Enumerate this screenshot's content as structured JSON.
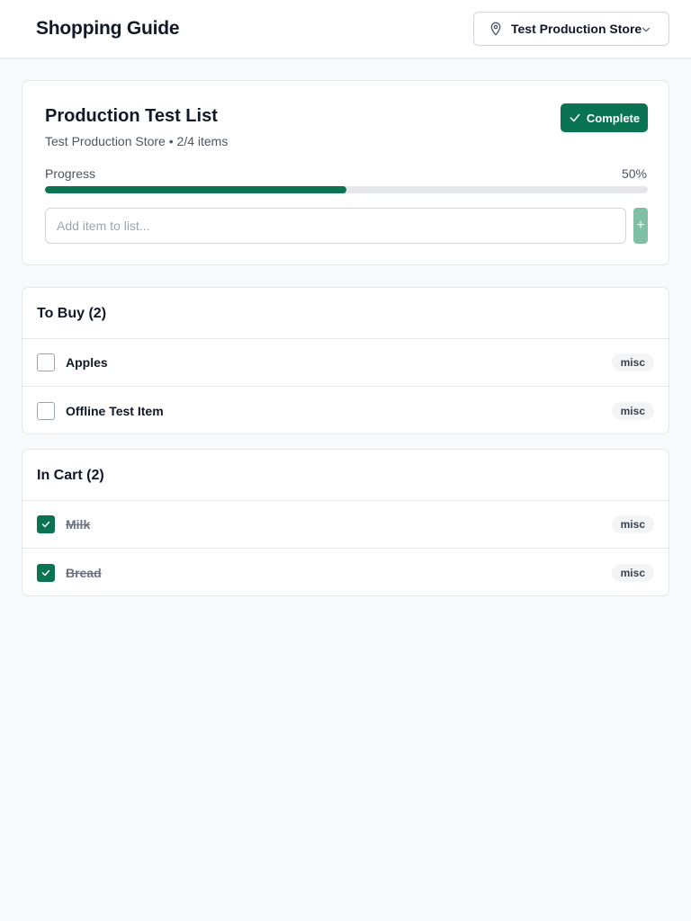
{
  "app": {
    "title": "Shopping Guide"
  },
  "store_selector": {
    "label": "Test Production Store",
    "icon": "map-pin-icon"
  },
  "list": {
    "title": "Production Test List",
    "subtitle": "Test Production Store • 2/4 items",
    "complete_label": "Complete",
    "progress_label": "Progress",
    "progress_text": "50%",
    "progress_fraction": 0.5,
    "add_placeholder": "Add item to list...",
    "add_button": "+"
  },
  "to_buy": {
    "title": "To Buy (2)",
    "items": [
      {
        "name": "Apples",
        "tag": "misc",
        "checked": false
      },
      {
        "name": "Offline Test Item",
        "tag": "misc",
        "checked": false
      }
    ]
  },
  "in_cart": {
    "title": "In Cart (2)",
    "items": [
      {
        "name": "Milk",
        "tag": "misc",
        "checked": true
      },
      {
        "name": "Bread",
        "tag": "misc",
        "checked": true
      }
    ]
  },
  "colors": {
    "accent": "#0a7352",
    "accent_light": "#7fbfa6",
    "border": "#e5e7eb",
    "background": "#f8f9fa"
  }
}
